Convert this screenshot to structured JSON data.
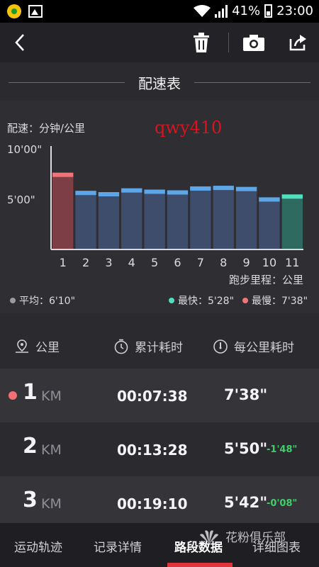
{
  "status_bar": {
    "battery": "41%",
    "time": "23:00"
  },
  "page_title": "配速表",
  "chart_data": {
    "type": "bar",
    "unit_label": "配速：分钟/公里",
    "xlabel": "跑步里程：公里",
    "ytick_labels": [
      "10'00\"",
      "5'00\""
    ],
    "categories": [
      "1",
      "2",
      "3",
      "4",
      "5",
      "6",
      "7",
      "8",
      "9",
      "10",
      "11"
    ],
    "values_label": [
      "7'38\"",
      "5'50\"",
      "5'42\"",
      "6'05\"",
      "5'57\"",
      "5'53\"",
      "6'16\"",
      "6'20\"",
      "6'13\"",
      "5'11\"",
      "5'28\""
    ],
    "values": [
      7.63,
      5.83,
      5.7,
      6.08,
      5.95,
      5.88,
      6.27,
      6.33,
      6.22,
      5.18,
      5.47
    ],
    "ylim": [
      0,
      10
    ],
    "slowest_index": 0,
    "fastest_index": 10,
    "colors": {
      "normal": "#3e4d6b",
      "normal_cap": "#5da7e8",
      "slow": "#7d3f45",
      "slow_cap": "#f0757a",
      "fast": "#2f6a60",
      "fast_cap": "#4fe0bd"
    }
  },
  "watermark": "qwy410",
  "stats": {
    "avg": "平均：6'10\"",
    "fast": "最快：5'28\"",
    "slow": "最慢：7'38\""
  },
  "table": {
    "headers": [
      "公里",
      "累计耗时",
      "每公里耗时"
    ],
    "unit": "KM",
    "rows": [
      {
        "km": "1",
        "time": "00:07:38",
        "pace": "7'38\"",
        "diff": ""
      },
      {
        "km": "2",
        "time": "00:13:28",
        "pace": "5'50\"",
        "diff": "-1'48\""
      },
      {
        "km": "3",
        "time": "00:19:10",
        "pace": "5'42\"",
        "diff": "-0'08\""
      }
    ]
  },
  "tabs": [
    "运动轨迹",
    "记录详情",
    "路段数据",
    "详细图表"
  ],
  "brand": "花粉俱乐部"
}
